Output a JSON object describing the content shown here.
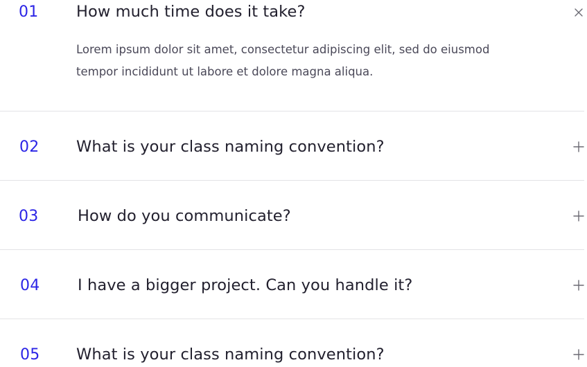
{
  "faq": {
    "items": [
      {
        "number": "01",
        "question": "How much time does it take?",
        "answer": "Lorem ipsum dolor sit amet, consectetur adipiscing elit, sed do eiusmod tempor incididunt ut labore et dolore magna aliqua.",
        "expanded": true,
        "toggle_icon": "close-icon"
      },
      {
        "number": "02",
        "question": "What is your class naming convention?",
        "expanded": false,
        "toggle_icon": "plus-icon"
      },
      {
        "number": "03",
        "question": "How do you communicate?",
        "expanded": false,
        "toggle_icon": "plus-icon"
      },
      {
        "number": "04",
        "question": "I have a bigger project. Can you handle it?",
        "expanded": false,
        "toggle_icon": "plus-icon"
      },
      {
        "number": "05",
        "question": "What is your class naming convention?",
        "expanded": false,
        "toggle_icon": "plus-icon"
      }
    ]
  },
  "colors": {
    "accent": "#2b24e6",
    "question": "#22202e",
    "answer": "#4a4858",
    "divider": "#e3e3e6",
    "icon": "#6b6a73"
  }
}
